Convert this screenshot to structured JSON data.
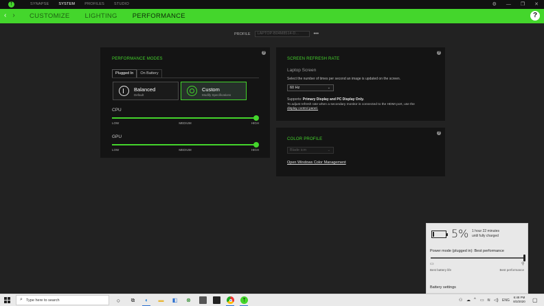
{
  "topnav": {
    "items": [
      "SYNAPSE",
      "SYSTEM",
      "PROFILES",
      "STUDIO"
    ],
    "active": "SYSTEM"
  },
  "window_controls": {
    "settings": "⚙",
    "minimize": "—",
    "maximize": "❐",
    "close": "✕"
  },
  "greenbar": {
    "back": "‹",
    "forward": "›",
    "tabs": [
      "CUSTOMIZE",
      "LIGHTING",
      "PERFORMANCE"
    ],
    "active": "PERFORMANCE",
    "help": "?"
  },
  "profile": {
    "label": "PROFILE",
    "value": "LAPTOP-B04M8514-D...",
    "more": "•••"
  },
  "performance_modes": {
    "title": "PERFORMANCE MODES",
    "info": "?",
    "tabs": [
      "Plugged In",
      "On Battery"
    ],
    "active_tab": "Plugged In",
    "modes": [
      {
        "name": "Balanced",
        "subtitle": "Default"
      },
      {
        "name": "Custom",
        "subtitle": "Modify Specifications"
      }
    ],
    "selected_mode": "Custom",
    "cpu": {
      "label": "CPU",
      "level": 1.0,
      "ticks": [
        "LOW",
        "MEDIUM",
        "HIGH"
      ]
    },
    "gpu": {
      "label": "GPU",
      "level": 1.0,
      "ticks": [
        "LOW",
        "MEDIUM",
        "HIGH"
      ]
    }
  },
  "refresh_rate": {
    "title": "SCREEN REFRESH RATE",
    "info": "?",
    "subtitle": "Laptop Screen",
    "description": "Select the number of times per second an image is updated on the screen.",
    "value": "60 Hz",
    "supports_prefix": "Supports: ",
    "supports_bold": "Primary Display and PC Display Only.",
    "note_line1": "To adjust refresh rate when a secondary monitor is connected to the HDMI port, use the",
    "note_link": "display control panel."
  },
  "color_profile": {
    "title": "COLOR PROFILE",
    "info": "?",
    "value": "Blade icm",
    "link": "Open Windows Color Management"
  },
  "battery_flyout": {
    "percent": "5%",
    "time_line1": "1 hour 22 minutes",
    "time_line2": "until fully charged",
    "power_mode_label": "Power mode (plugged in): Best performance",
    "power_level": 1.0,
    "left_label": "Best battery life",
    "right_label": "Best performance",
    "settings": "Battery settings"
  },
  "taskbar": {
    "search_placeholder": "Type here to search",
    "lang": "ENG",
    "time": "6:48 PM",
    "date": "8/3/2020"
  },
  "colors": {
    "accent": "#44d62c",
    "background": "#222222",
    "panel": "#141414"
  }
}
